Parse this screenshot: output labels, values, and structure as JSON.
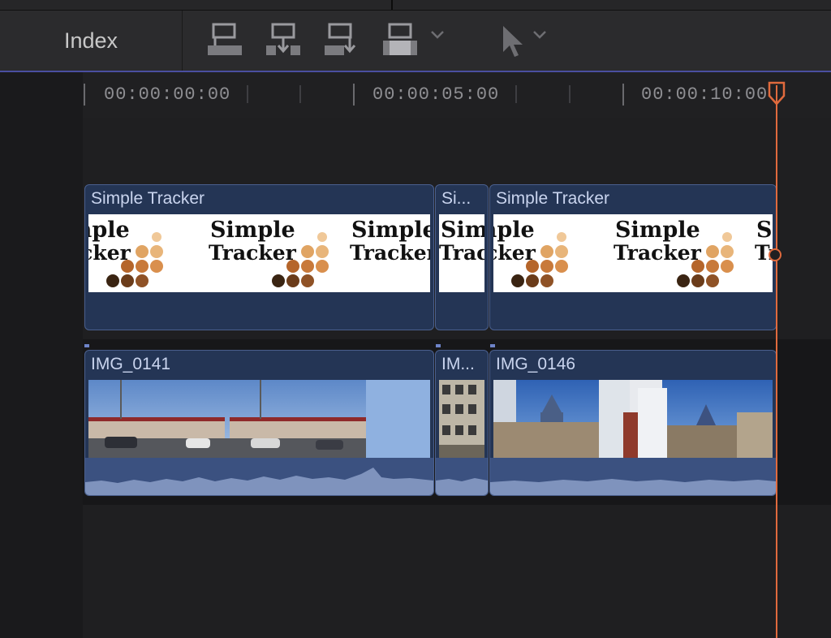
{
  "toolbar": {
    "index_label": "Index",
    "tools": [
      "connect-clip-icon",
      "insert-clip-icon",
      "append-clip-icon",
      "overwrite-clip-icon",
      "chevron-down-icon",
      "select-tool-icon",
      "chevron-down-icon"
    ]
  },
  "ruler": {
    "timecodes": [
      "00:00:00:00",
      "00:00:05:00",
      "00:00:10:00"
    ]
  },
  "tracks": {
    "title_clips": [
      {
        "label": "Simple Tracker"
      },
      {
        "label": "Si..."
      },
      {
        "label": "Simple Tracker"
      }
    ],
    "video_clips": [
      {
        "label": "IMG_0141"
      },
      {
        "label": "IM..."
      },
      {
        "label": "IMG_0146"
      }
    ],
    "logo_text": {
      "line1": "Simple",
      "line2": "Tracker"
    }
  },
  "colors": {
    "playhead": "#e06a3d",
    "clip_fill": "#243555",
    "audio_wave": "#7f93bd",
    "toolbar_accent": "#4a4fa0"
  }
}
